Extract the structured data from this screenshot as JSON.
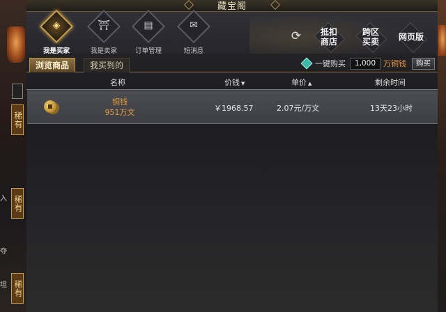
{
  "window": {
    "title": "藏宝阁"
  },
  "nav": {
    "items": [
      {
        "label": "我是买家",
        "icon": "coin-icon",
        "active": true
      },
      {
        "label": "我是卖家",
        "icon": "stall-icon",
        "active": false
      },
      {
        "label": "订单管理",
        "icon": "ledger-icon",
        "active": false
      },
      {
        "label": "短消息",
        "icon": "envelope-icon",
        "active": false
      }
    ],
    "refresh_icon": "refresh-icon",
    "right_buttons": [
      {
        "label_line1": "抵扣",
        "label_line2": "商店"
      },
      {
        "label_line1": "跨区",
        "label_line2": "买卖"
      },
      {
        "label_line1": "网页版",
        "label_line2": ""
      }
    ]
  },
  "tabs": [
    {
      "label": "浏览商品",
      "active": true
    },
    {
      "label": "我买到的",
      "active": false
    }
  ],
  "quick_buy": {
    "label": "一键购买",
    "value": "1,000",
    "unit": "万铜钱",
    "button": "购买"
  },
  "table": {
    "columns": [
      {
        "label": "名称",
        "sortable": false
      },
      {
        "label": "价钱",
        "sortable": true
      },
      {
        "label": "单价",
        "sortable": true
      },
      {
        "label": "剩余时间",
        "sortable": false
      }
    ],
    "rows": [
      {
        "icon": "copper-coin-icon",
        "name": "铜钱",
        "amount": "951万文",
        "price": "￥1968.57",
        "unit_price": "2.07元/万文",
        "remaining": "13天23小时"
      }
    ]
  },
  "sidebar_left": {
    "tags": [
      "稀有",
      "稀有",
      "稀有"
    ],
    "glyphs": [
      "入",
      "夺",
      "坦"
    ]
  },
  "colors": {
    "accent_gold": "#c9a04c",
    "item_name": "#e69a3c",
    "unit_orange": "#e7943a"
  }
}
